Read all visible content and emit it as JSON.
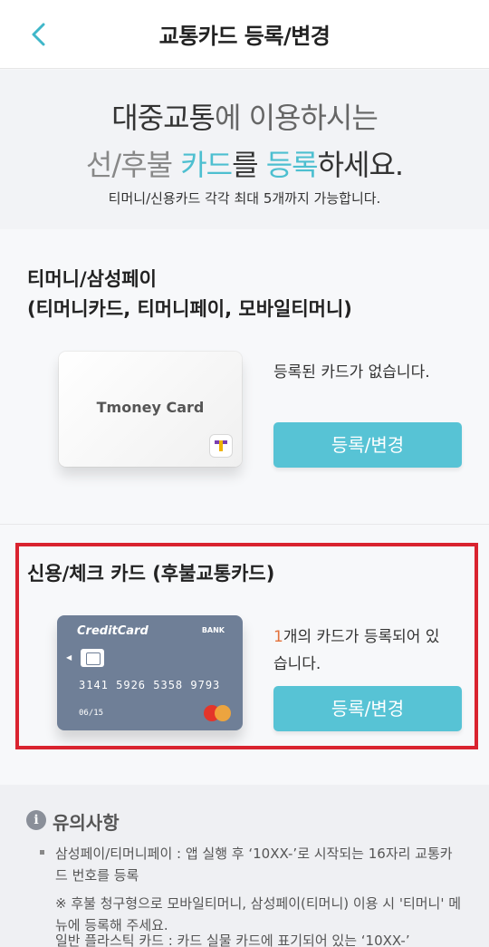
{
  "header": {
    "title": "교통카드 등록/변경"
  },
  "intro": {
    "line1_emph": "대중교통",
    "line1_rest": "에 이용하시는",
    "line2_pre": "선/후불 ",
    "line2_accent1": "카드",
    "line2_mid": "를 ",
    "line2_accent2": "등록",
    "line2_post": "하세요.",
    "note": "티머니/신용카드 각각 최대 5개까지 가능합니다."
  },
  "tmoney": {
    "title_line1": "티머니/삼성페이",
    "title_line2": "(티머니카드, 티머니페이, 모바일티머니)",
    "card_name": "Tmoney Card",
    "status": "등록된 카드가 없습니다.",
    "button": "등록/변경"
  },
  "credit": {
    "title": "신용/체크 카드 (후불교통카드)",
    "card_brand": "CreditCard",
    "card_bank": "BANK",
    "card_number": "3141 5926 5358 9793",
    "card_expiry": "06/15",
    "status_count": "1",
    "status_line1": "개의 카드가 등록되어 있",
    "status_line2": "습니다.",
    "button": "등록/변경"
  },
  "notice": {
    "title": "유의사항",
    "item1": "삼성페이/티머니페이 : 앱 실행 후 ‘10XX-’로 시작되는 16자리 교통카드 번호를 등록",
    "item1_sub": "※ 후불 청구형으로 모바일티머니, 삼성페이(티머니) 이용 시 '티머니' 메뉴에 등록해 주세요.",
    "item2_partial": "일반 플라스틱 카드 : 카드 실물 카드에 표기되어 있는 ‘10XX-’"
  },
  "colors": {
    "accent": "#57c3d5",
    "highlight": "#d9232f",
    "count": "#e3723c"
  }
}
